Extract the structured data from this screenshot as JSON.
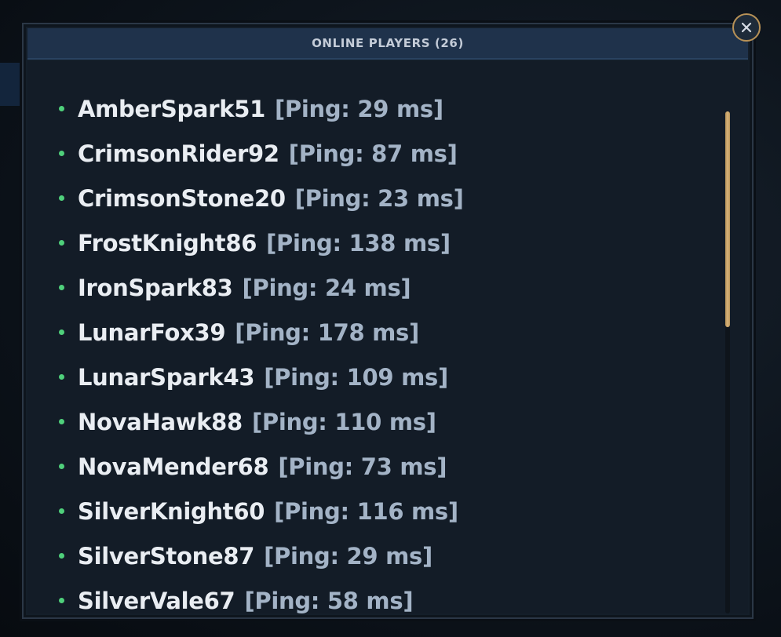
{
  "dialog": {
    "title": "ONLINE PLAYERS (26)",
    "close_icon": "close-icon"
  },
  "players": [
    {
      "name": "AmberSpark51",
      "ping": "[Ping: 29 ms]"
    },
    {
      "name": "CrimsonRider92",
      "ping": "[Ping: 87 ms]"
    },
    {
      "name": "CrimsonStone20",
      "ping": "[Ping: 23 ms]"
    },
    {
      "name": "FrostKnight86",
      "ping": "[Ping: 138 ms]"
    },
    {
      "name": "IronSpark83",
      "ping": "[Ping: 24 ms]"
    },
    {
      "name": "LunarFox39",
      "ping": "[Ping: 178 ms]"
    },
    {
      "name": "LunarSpark43",
      "ping": "[Ping: 109 ms]"
    },
    {
      "name": "NovaHawk88",
      "ping": "[Ping: 110 ms]"
    },
    {
      "name": "NovaMender68",
      "ping": "[Ping: 73 ms]"
    },
    {
      "name": "SilverKnight60",
      "ping": "[Ping: 116 ms]"
    },
    {
      "name": "SilverStone87",
      "ping": "[Ping: 29 ms]"
    },
    {
      "name": "SilverVale67",
      "ping": "[Ping: 58 ms]"
    }
  ],
  "scrollbar": {
    "thumb_fraction": 0.43,
    "position": 0
  },
  "colors": {
    "online_dot": "#4fd07b",
    "accent_gold": "#c9a46a",
    "header_bg": "#1f324b",
    "panel_bg": "#141e29"
  }
}
